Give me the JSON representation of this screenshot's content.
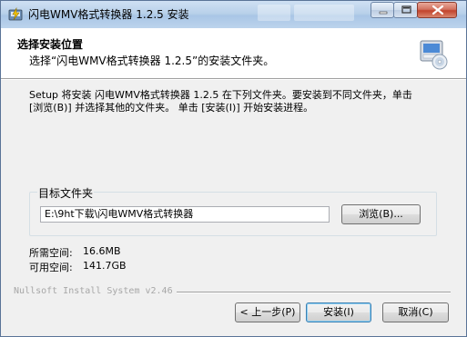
{
  "window": {
    "title": "闪电WMV格式转换器 1.2.5 安装",
    "controls": {
      "minimize": "minimize",
      "maximize": "maximize",
      "close": "close"
    }
  },
  "header": {
    "title": "选择安装位置",
    "subtitle": "选择“闪电WMV格式转换器 1.2.5”的安装文件夹。",
    "icon": "installer-disc-icon"
  },
  "body": {
    "instruction_line1": "Setup 将安装 闪电WMV格式转换器 1.2.5 在下列文件夹。要安装到不同文件夹，单击",
    "instruction_line2": "[浏览(B)] 并选择其他的文件夹。 单击 [安装(I)] 开始安装进程。"
  },
  "destination": {
    "group_label": "目标文件夹",
    "path": "E:\\9ht下载\\闪电WMV格式转换器",
    "browse_label": "浏览(B)..."
  },
  "space": {
    "required_label": "所需空间:",
    "required_value": "16.6MB",
    "available_label": "可用空间:",
    "available_value": "141.7GB"
  },
  "footer": {
    "brand": "Nullsoft Install System v2.46",
    "back_label": "< 上一步(P)",
    "install_label": "安装(I)",
    "cancel_label": "取消(C)"
  },
  "colors": {
    "titlebar": "#b9d1ea",
    "dialog_bg": "#f0f0f0",
    "close_button": "#c2432c",
    "focus_border": "#3c7fb1"
  }
}
